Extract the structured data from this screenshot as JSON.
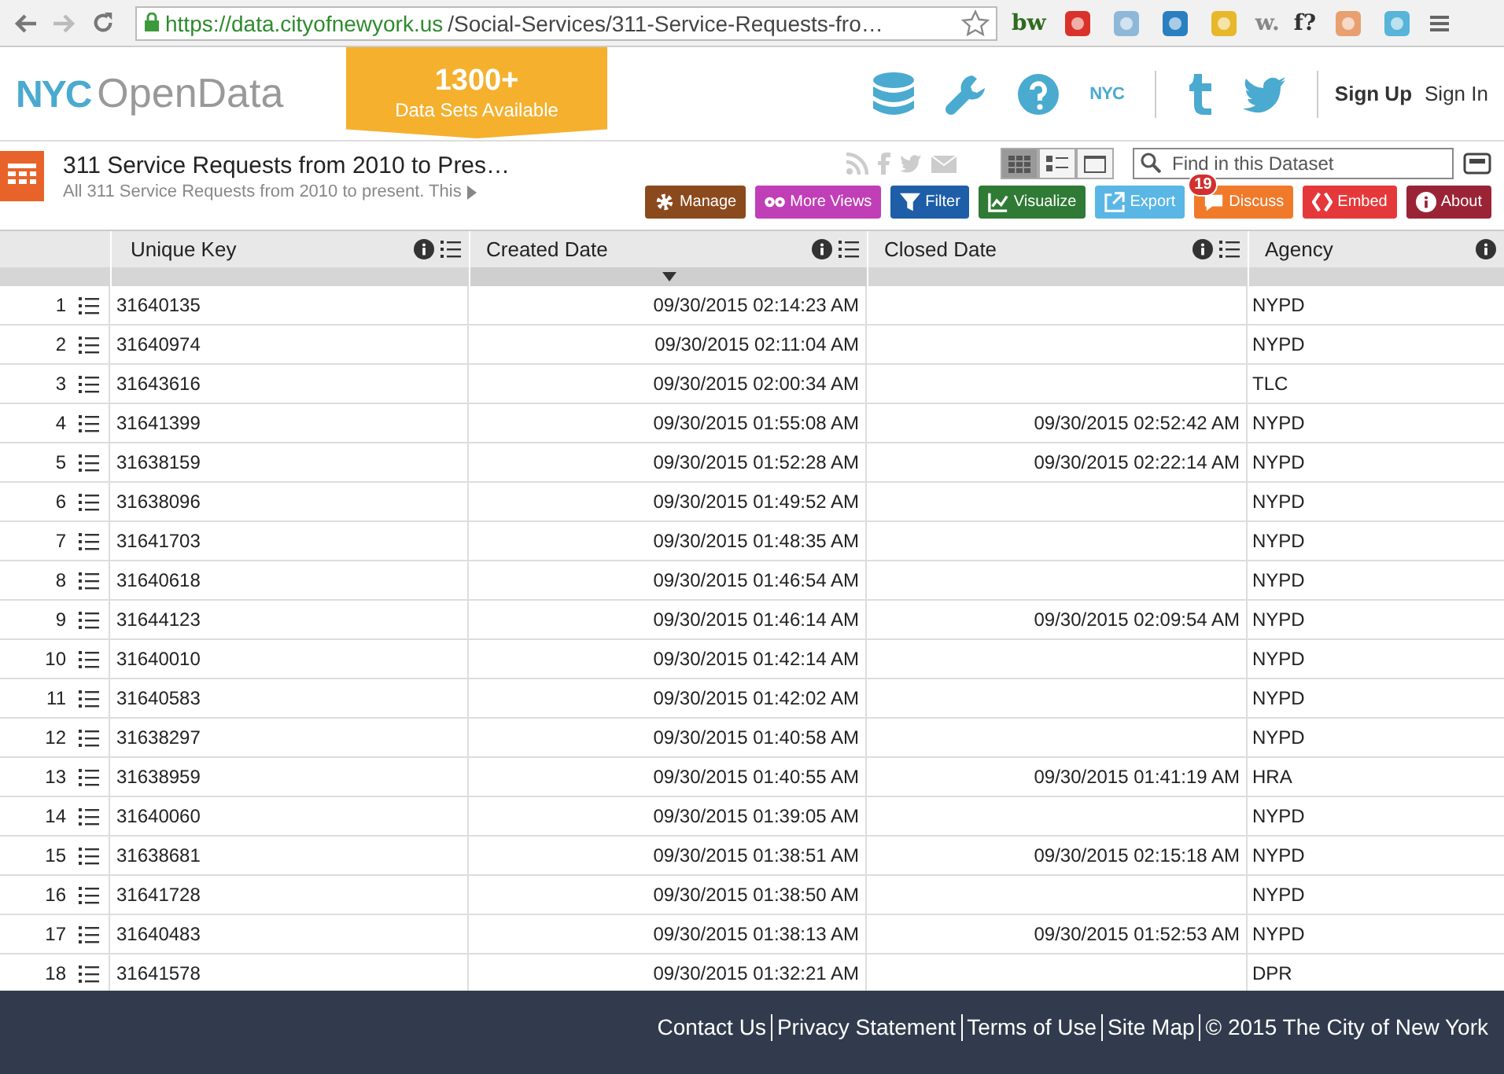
{
  "browser": {
    "url_host": "https://data.cityofnewyork.us",
    "url_path": "/Social-Services/311-Service-Requests-fro…",
    "extensions": [
      {
        "kind": "text",
        "label": "bw",
        "color": "#2e6b1f"
      },
      {
        "kind": "icon",
        "color": "#d9322b"
      },
      {
        "kind": "icon",
        "color": "#8fb8d8"
      },
      {
        "kind": "icon",
        "color": "#2a7fc0"
      },
      {
        "kind": "icon",
        "color": "#e6b82a"
      },
      {
        "kind": "text",
        "label": "w.",
        "color": "#888888"
      },
      {
        "kind": "text",
        "label": "f?",
        "color": "#333333"
      },
      {
        "kind": "icon",
        "color": "#e8a070"
      },
      {
        "kind": "icon",
        "color": "#58b4d8"
      }
    ]
  },
  "header": {
    "logo_bold": "NYC",
    "logo_light": "OpenData",
    "banner_count": "1300+",
    "banner_text": "Data Sets Available",
    "nyc_link": "NYC",
    "links": [
      "Sign Up",
      "Sign In"
    ]
  },
  "dataset": {
    "title": "311 Service Requests from 2010 to Pres…",
    "description": "All 311 Service Requests from 2010 to present. This",
    "views": [
      {
        "selected": true
      },
      {
        "selected": false
      },
      {
        "selected": false
      }
    ],
    "search": {
      "placeholder": "Find in this Dataset"
    },
    "actions": [
      {
        "label": "Manage",
        "color": "#8b4a1e"
      },
      {
        "label": "More Views",
        "color": "#c13fb6"
      },
      {
        "label": "Filter",
        "color": "#1e5ea8"
      },
      {
        "label": "Visualize",
        "color": "#2f7a35"
      },
      {
        "label": "Export",
        "color": "#5ab6e4"
      },
      {
        "label": "Discuss",
        "color": "#f07a2a",
        "badge": "19"
      },
      {
        "label": "Embed",
        "color": "#e5383a"
      },
      {
        "label": "About",
        "color": "#9a2436"
      }
    ]
  },
  "table": {
    "columns": [
      {
        "label": "Unique Key",
        "sorted": false
      },
      {
        "label": "Created Date",
        "sorted": true
      },
      {
        "label": "Closed Date",
        "sorted": false
      },
      {
        "label": "Agency",
        "sorted": false
      }
    ],
    "rows": [
      {
        "number": "1",
        "cells": [
          "31640135",
          "09/30/2015 02:14:23 AM",
          "",
          "NYPD"
        ]
      },
      {
        "number": "2",
        "cells": [
          "31640974",
          "09/30/2015 02:11:04 AM",
          "",
          "NYPD"
        ]
      },
      {
        "number": "3",
        "cells": [
          "31643616",
          "09/30/2015 02:00:34 AM",
          "",
          "TLC"
        ]
      },
      {
        "number": "4",
        "cells": [
          "31641399",
          "09/30/2015 01:55:08 AM",
          "09/30/2015 02:52:42 AM",
          "NYPD"
        ]
      },
      {
        "number": "5",
        "cells": [
          "31638159",
          "09/30/2015 01:52:28 AM",
          "09/30/2015 02:22:14 AM",
          "NYPD"
        ]
      },
      {
        "number": "6",
        "cells": [
          "31638096",
          "09/30/2015 01:49:52 AM",
          "",
          "NYPD"
        ]
      },
      {
        "number": "7",
        "cells": [
          "31641703",
          "09/30/2015 01:48:35 AM",
          "",
          "NYPD"
        ]
      },
      {
        "number": "8",
        "cells": [
          "31640618",
          "09/30/2015 01:46:54 AM",
          "",
          "NYPD"
        ]
      },
      {
        "number": "9",
        "cells": [
          "31644123",
          "09/30/2015 01:46:14 AM",
          "09/30/2015 02:09:54 AM",
          "NYPD"
        ]
      },
      {
        "number": "10",
        "cells": [
          "31640010",
          "09/30/2015 01:42:14 AM",
          "",
          "NYPD"
        ]
      },
      {
        "number": "11",
        "cells": [
          "31640583",
          "09/30/2015 01:42:02 AM",
          "",
          "NYPD"
        ]
      },
      {
        "number": "12",
        "cells": [
          "31638297",
          "09/30/2015 01:40:58 AM",
          "",
          "NYPD"
        ]
      },
      {
        "number": "13",
        "cells": [
          "31638959",
          "09/30/2015 01:40:55 AM",
          "09/30/2015 01:41:19 AM",
          "HRA"
        ]
      },
      {
        "number": "14",
        "cells": [
          "31640060",
          "09/30/2015 01:39:05 AM",
          "",
          "NYPD"
        ]
      },
      {
        "number": "15",
        "cells": [
          "31638681",
          "09/30/2015 01:38:51 AM",
          "09/30/2015 02:15:18 AM",
          "NYPD"
        ]
      },
      {
        "number": "16",
        "cells": [
          "31641728",
          "09/30/2015 01:38:50 AM",
          "",
          "NYPD"
        ]
      },
      {
        "number": "17",
        "cells": [
          "31640483",
          "09/30/2015 01:38:13 AM",
          "09/30/2015 01:52:53 AM",
          "NYPD"
        ]
      },
      {
        "number": "18",
        "cells": [
          "31641578",
          "09/30/2015 01:32:21 AM",
          "",
          "DPR"
        ]
      }
    ]
  },
  "footer": {
    "links": [
      "Contact Us",
      "Privacy Statement",
      "Terms of Use",
      "Site Map"
    ],
    "copyright": "© 2015 The City of New York"
  }
}
